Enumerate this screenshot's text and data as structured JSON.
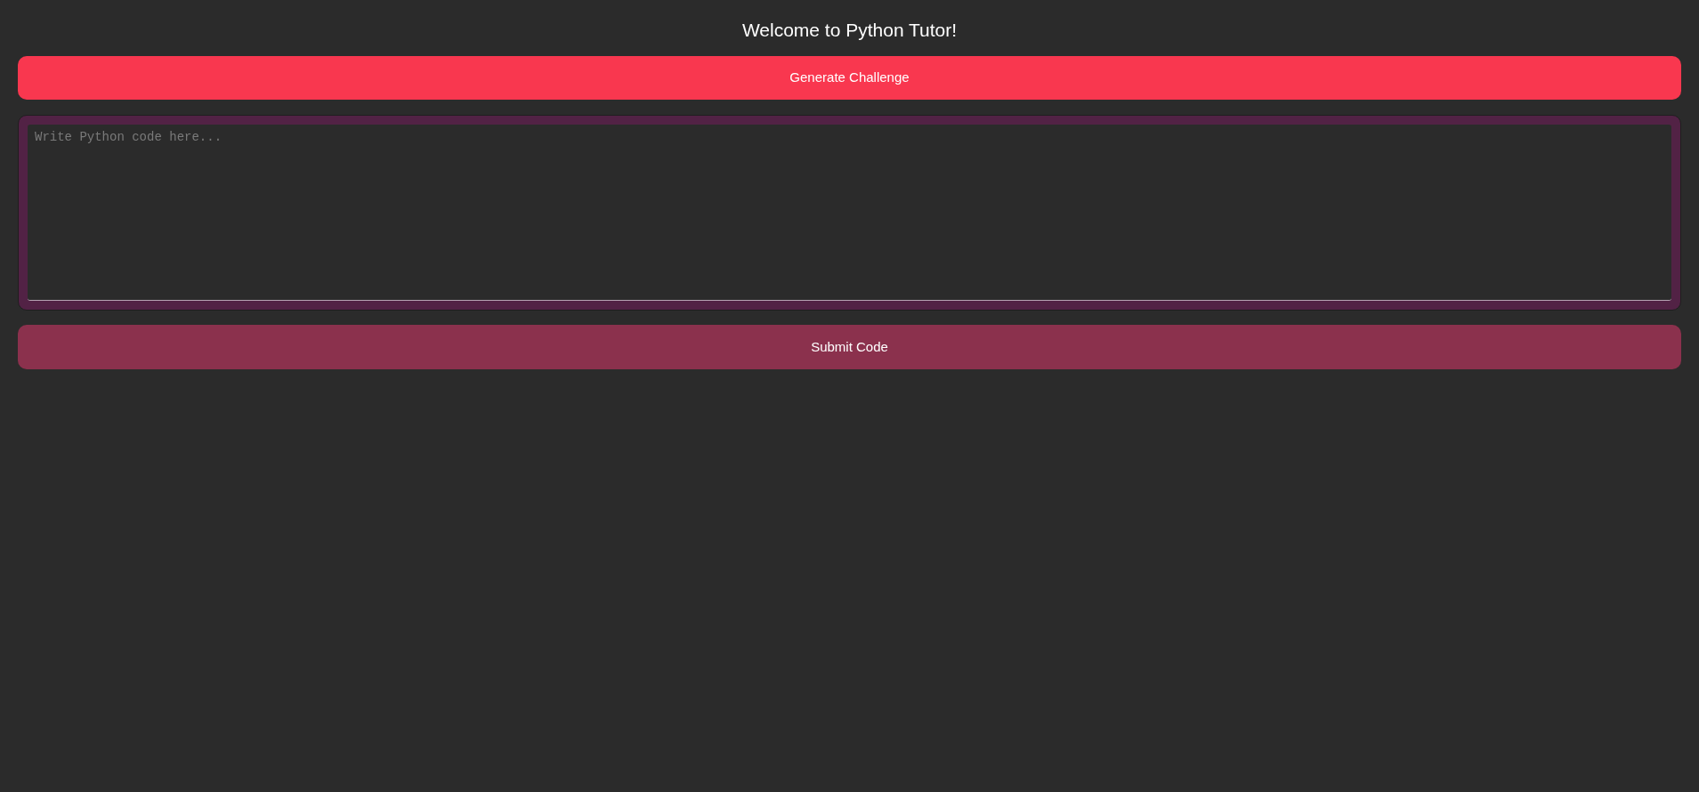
{
  "title": "Welcome to Python Tutor!",
  "generate_button": {
    "label": "Generate Challenge"
  },
  "code_editor": {
    "placeholder": "Write Python code here..."
  },
  "submit_button": {
    "label": "Submit Code"
  }
}
